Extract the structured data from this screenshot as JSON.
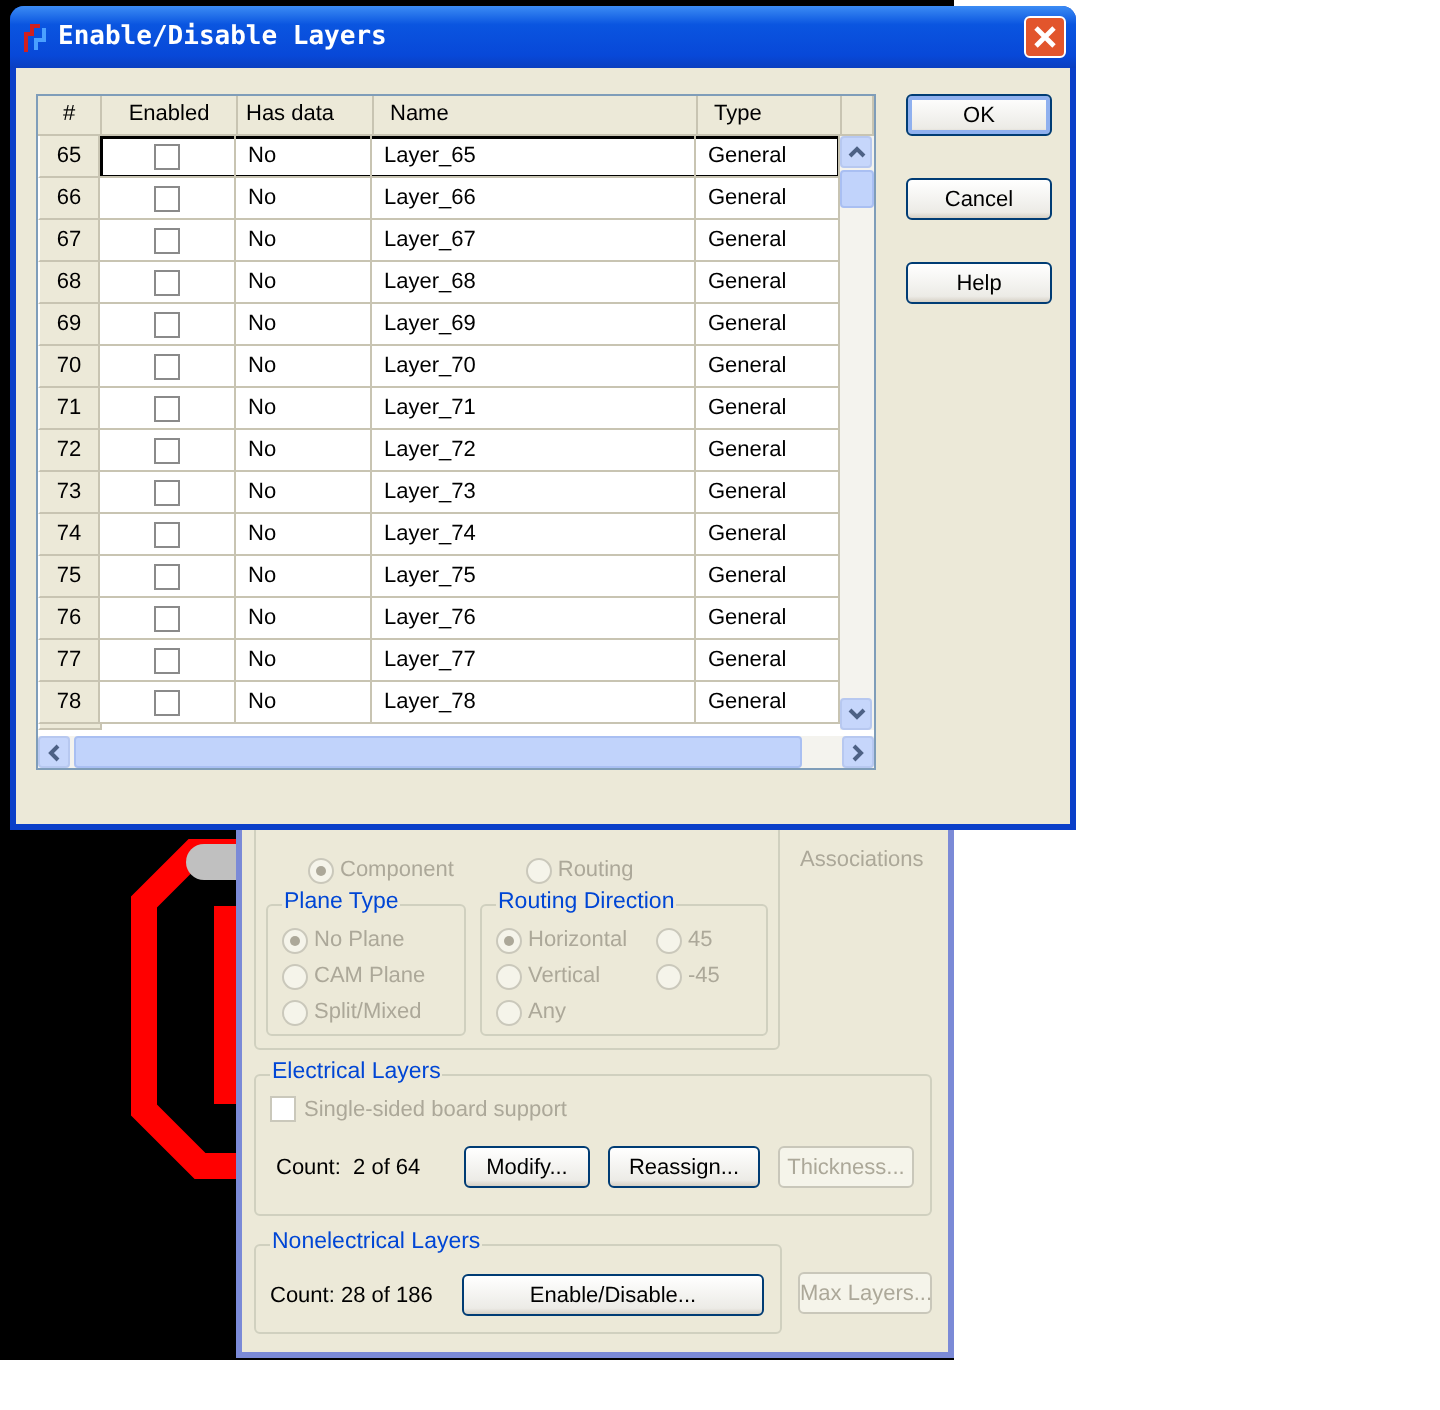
{
  "window": {
    "title": "Enable/Disable Layers"
  },
  "table": {
    "columns": [
      "#",
      "Enabled",
      "Has data",
      "Name",
      "Type"
    ],
    "rows": [
      {
        "number": "65",
        "enabled": false,
        "has_data": "No",
        "name": "Layer_65",
        "type": "General",
        "selected": true
      },
      {
        "number": "66",
        "enabled": false,
        "has_data": "No",
        "name": "Layer_66",
        "type": "General",
        "selected": false
      },
      {
        "number": "67",
        "enabled": false,
        "has_data": "No",
        "name": "Layer_67",
        "type": "General",
        "selected": false
      },
      {
        "number": "68",
        "enabled": false,
        "has_data": "No",
        "name": "Layer_68",
        "type": "General",
        "selected": false
      },
      {
        "number": "69",
        "enabled": false,
        "has_data": "No",
        "name": "Layer_69",
        "type": "General",
        "selected": false
      },
      {
        "number": "70",
        "enabled": false,
        "has_data": "No",
        "name": "Layer_70",
        "type": "General",
        "selected": false
      },
      {
        "number": "71",
        "enabled": false,
        "has_data": "No",
        "name": "Layer_71",
        "type": "General",
        "selected": false
      },
      {
        "number": "72",
        "enabled": false,
        "has_data": "No",
        "name": "Layer_72",
        "type": "General",
        "selected": false
      },
      {
        "number": "73",
        "enabled": false,
        "has_data": "No",
        "name": "Layer_73",
        "type": "General",
        "selected": false
      },
      {
        "number": "74",
        "enabled": false,
        "has_data": "No",
        "name": "Layer_74",
        "type": "General",
        "selected": false
      },
      {
        "number": "75",
        "enabled": false,
        "has_data": "No",
        "name": "Layer_75",
        "type": "General",
        "selected": false
      },
      {
        "number": "76",
        "enabled": false,
        "has_data": "No",
        "name": "Layer_76",
        "type": "General",
        "selected": false
      },
      {
        "number": "77",
        "enabled": false,
        "has_data": "No",
        "name": "Layer_77",
        "type": "General",
        "selected": false
      },
      {
        "number": "78",
        "enabled": false,
        "has_data": "No",
        "name": "Layer_78",
        "type": "General",
        "selected": false
      }
    ]
  },
  "buttons": [
    {
      "label": "OK",
      "default": true
    },
    {
      "label": "Cancel",
      "default": false
    },
    {
      "label": "Help",
      "default": false
    }
  ],
  "background_dialog": {
    "associations_button": {
      "label": "Associations",
      "disabled": true
    },
    "layer_type_options": [
      {
        "label": "Component",
        "selected": true,
        "disabled": true
      },
      {
        "label": "Routing",
        "selected": false,
        "disabled": true
      }
    ],
    "plane_type": {
      "title": "Plane Type",
      "options": [
        {
          "label": "No Plane",
          "selected": true,
          "disabled": true
        },
        {
          "label": "CAM Plane",
          "selected": false,
          "disabled": true
        },
        {
          "label": "Split/Mixed",
          "selected": false,
          "disabled": true
        }
      ]
    },
    "routing_direction": {
      "title": "Routing Direction",
      "options": [
        {
          "label": "Horizontal",
          "selected": true,
          "disabled": true
        },
        {
          "label": "Vertical",
          "selected": false,
          "disabled": true
        },
        {
          "label": "Any",
          "selected": false,
          "disabled": true
        },
        {
          "label": "45",
          "selected": false,
          "disabled": true
        },
        {
          "label": "-45",
          "selected": false,
          "disabled": true
        }
      ]
    },
    "electrical_layers": {
      "title": "Electrical Layers",
      "single_sided": {
        "label": "Single-sided board support",
        "checked": false,
        "disabled": true
      },
      "count": "Count:  2 of 64",
      "buttons": [
        {
          "label": "Modify...",
          "disabled": false
        },
        {
          "label": "Reassign...",
          "disabled": false
        },
        {
          "label": "Thickness...",
          "disabled": true
        }
      ]
    },
    "nonelectrical_layers": {
      "title": "Nonelectrical Layers",
      "count": "Count: 28 of 186",
      "buttons": [
        {
          "label": "Enable/Disable...",
          "disabled": false
        },
        {
          "label": "Max Layers...",
          "disabled": true
        }
      ]
    }
  }
}
